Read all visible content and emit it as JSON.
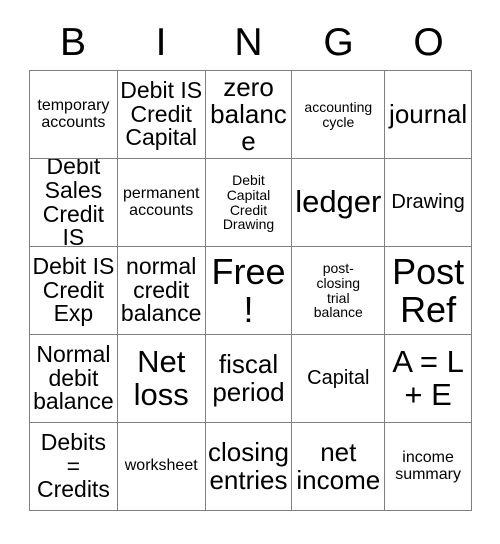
{
  "card": {
    "title_letters": [
      "B",
      "I",
      "N",
      "G",
      "O"
    ],
    "free_space_label": "Free!",
    "rows": [
      [
        {
          "text": "temporary\naccounts",
          "size": "fs-s"
        },
        {
          "text": "Debit IS\nCredit\nCapital",
          "size": "fs-l"
        },
        {
          "text": "zero\nbalance",
          "size": "fs-xl"
        },
        {
          "text": "accounting\ncycle",
          "size": "fs-xs"
        },
        {
          "text": "journal",
          "size": "fs-xl"
        }
      ],
      [
        {
          "text": "Debit\nSales\nCredit IS",
          "size": "fs-l"
        },
        {
          "text": "permanent\naccounts",
          "size": "fs-s"
        },
        {
          "text": "Debit\nCapital\nCredit\nDrawing",
          "size": "fs-xs"
        },
        {
          "text": "ledger",
          "size": "fs-xxl"
        },
        {
          "text": "Drawing",
          "size": "fs-m"
        }
      ],
      [
        {
          "text": "Debit IS\nCredit\nExp",
          "size": "fs-l"
        },
        {
          "text": "normal\ncredit\nbalance",
          "size": "fs-l"
        },
        {
          "text": "Free!",
          "size": "fs-huge"
        },
        {
          "text": "post-\nclosing\ntrial\nbalance",
          "size": "fs-xs"
        },
        {
          "text": "Post\nRef",
          "size": "fs-huge"
        }
      ],
      [
        {
          "text": "Normal\ndebit\nbalance",
          "size": "fs-l"
        },
        {
          "text": "Net\nloss",
          "size": "fs-xxl"
        },
        {
          "text": "fiscal\nperiod",
          "size": "fs-xl"
        },
        {
          "text": "Capital",
          "size": "fs-m"
        },
        {
          "text": "A = L\n+ E",
          "size": "fs-xxl"
        }
      ],
      [
        {
          "text": "Debits\n=\nCredits",
          "size": "fs-l"
        },
        {
          "text": "worksheet",
          "size": "fs-s"
        },
        {
          "text": "closing\nentries",
          "size": "fs-xl"
        },
        {
          "text": "net\nincome",
          "size": "fs-xl"
        },
        {
          "text": "income\nsummary",
          "size": "fs-s"
        }
      ]
    ]
  }
}
